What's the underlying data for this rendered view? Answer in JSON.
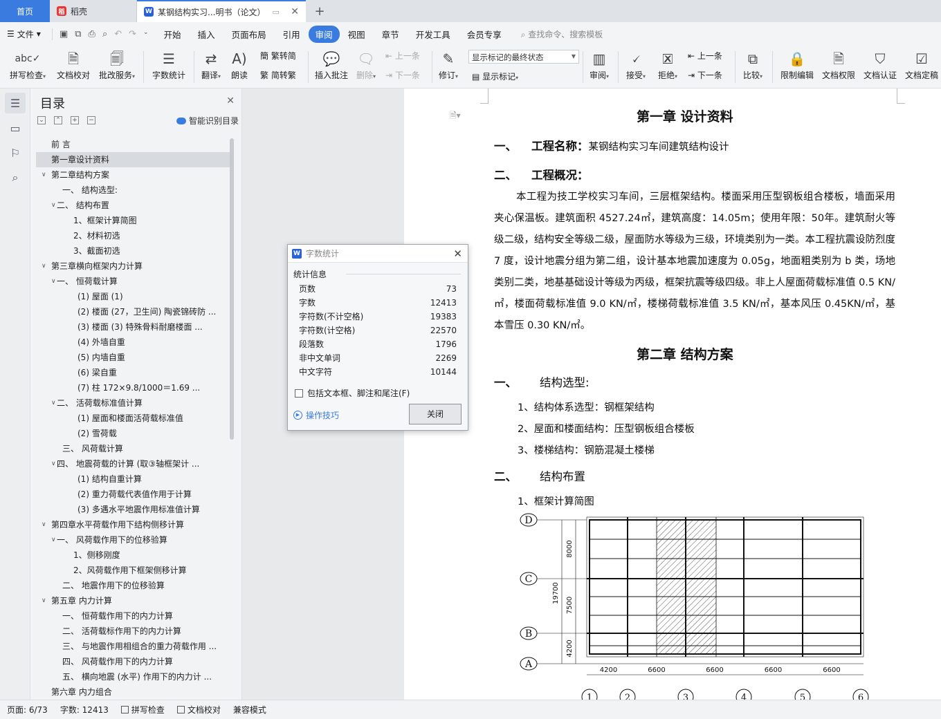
{
  "tabs": {
    "home": "首页",
    "daoke": "稻壳",
    "doc": "某钢结构实习...明书（论文）"
  },
  "menu": {
    "file": "文件",
    "items": [
      "开始",
      "插入",
      "页面布局",
      "引用",
      "审阅",
      "视图",
      "章节",
      "开发工具",
      "会员专享"
    ],
    "active": "审阅",
    "search": "查找命令、搜索模板"
  },
  "ribbon": {
    "spell": "拼写检查",
    "proof": "文档校对",
    "batch": "批改服务",
    "wordcount": "字数统计",
    "translate": "翻译",
    "read": "朗读",
    "to_trad": "繁转简",
    "to_simp": "简转繁",
    "insert_comment": "插入批注",
    "delete": "删除",
    "prev_comment": "上一条",
    "next_comment": "下一条",
    "revise": "修订",
    "markup_select": "显示标记的最终状态",
    "show_markup": "显示标记",
    "review": "审阅",
    "accept": "接受",
    "reject": "拒绝",
    "prev": "上一条",
    "next": "下一条",
    "compare": "比较",
    "restrict": "限制编辑",
    "permission": "文档权限",
    "certify": "文档认证",
    "finalize": "文档定稿"
  },
  "toc": {
    "title": "目录",
    "smart": "智能识别目录",
    "items": [
      {
        "text": "前  言",
        "level": 1,
        "toggle": ""
      },
      {
        "text": "第一章设计资料",
        "level": 1,
        "toggle": "",
        "current": true
      },
      {
        "text": "第二章结构方案",
        "level": 1,
        "toggle": "v"
      },
      {
        "text": "一、      结构选型:",
        "level": 3,
        "toggle": ""
      },
      {
        "text": "二、      结构布置",
        "level": 2,
        "toggle": "v"
      },
      {
        "text": "1、框架计算简图",
        "level": 4,
        "toggle": ""
      },
      {
        "text": "2、材料初选",
        "level": 4,
        "toggle": ""
      },
      {
        "text": "3、截面初选",
        "level": 4,
        "toggle": ""
      },
      {
        "text": "第三章横向框架内力计算",
        "level": 1,
        "toggle": "v"
      },
      {
        "text": "一、      恒荷载计算",
        "level": 2,
        "toggle": "v"
      },
      {
        "text": "(1) 屋面   (1)",
        "level": 5,
        "toggle": ""
      },
      {
        "text": "(2) 楼面 (27，卫生间) 陶瓷锦砖防 ...",
        "level": 5,
        "toggle": ""
      },
      {
        "text": "(3) 楼面 (3) 特殊骨料耐磨楼面     ...",
        "level": 5,
        "toggle": ""
      },
      {
        "text": "(4) 外墙自重",
        "level": 5,
        "toggle": ""
      },
      {
        "text": "(5) 内墙自重",
        "level": 5,
        "toggle": ""
      },
      {
        "text": "(6) 梁自重",
        "level": 5,
        "toggle": ""
      },
      {
        "text": "(7) 柱        172×9.8/1000＝1.69  ...",
        "level": 5,
        "toggle": ""
      },
      {
        "text": "二、      活荷载标准值计算",
        "level": 2,
        "toggle": "v"
      },
      {
        "text": "(1) 屋面和楼面活荷载标准值",
        "level": 5,
        "toggle": ""
      },
      {
        "text": "(2) 雪荷载",
        "level": 5,
        "toggle": ""
      },
      {
        "text": "三、      风荷载计算",
        "level": 3,
        "toggle": ""
      },
      {
        "text": "四、      地震荷载的计算 (取③轴框架计 ...",
        "level": 2,
        "toggle": "v"
      },
      {
        "text": "(1) 结构自重计算",
        "level": 5,
        "toggle": ""
      },
      {
        "text": "(2) 重力荷载代表值作用于计算",
        "level": 5,
        "toggle": ""
      },
      {
        "text": "(3) 多遇水平地震作用标准值计算",
        "level": 5,
        "toggle": ""
      },
      {
        "text": "第四章水平荷载作用下结构侧移计算",
        "level": 1,
        "toggle": "v"
      },
      {
        "text": "一、    风荷载作用下的位移验算",
        "level": 2,
        "toggle": "v"
      },
      {
        "text": "1、侧移刚度",
        "level": 4,
        "toggle": ""
      },
      {
        "text": "2、风荷载作用下框架侧移计算",
        "level": 4,
        "toggle": ""
      },
      {
        "text": "二、    地震作用下的位移验算",
        "level": 3,
        "toggle": ""
      },
      {
        "text": "第五章 内力计算",
        "level": 1,
        "toggle": "v"
      },
      {
        "text": "一、    恒荷载作用下的内力计算",
        "level": 3,
        "toggle": ""
      },
      {
        "text": "二、    活荷载标作用下的内力计算",
        "level": 3,
        "toggle": ""
      },
      {
        "text": "三、    与地震作用相组合的重力荷载作用 ...",
        "level": 3,
        "toggle": ""
      },
      {
        "text": "四、    风荷载作用下的内力计算",
        "level": 3,
        "toggle": ""
      },
      {
        "text": "五、    横向地震 (水平) 作用下的内力计 ...",
        "level": 3,
        "toggle": ""
      },
      {
        "text": "第六章 内力组合",
        "level": 1,
        "toggle": ""
      }
    ]
  },
  "dialog": {
    "title": "字数统计",
    "section": "统计信息",
    "rows": [
      {
        "label": "页数",
        "value": "73"
      },
      {
        "label": "字数",
        "value": "12413"
      },
      {
        "label": "字符数(不计空格)",
        "value": "19383"
      },
      {
        "label": "字符数(计空格)",
        "value": "22570"
      },
      {
        "label": "段落数",
        "value": "1796"
      },
      {
        "label": "非中文单词",
        "value": "2269"
      },
      {
        "label": "中文字符",
        "value": "10144"
      }
    ],
    "checkbox": "包括文本框、脚注和尾注(F)",
    "tip": "操作技巧",
    "close": "关闭"
  },
  "document": {
    "ch1_title": "第一章   设计资料",
    "s1_num": "一、",
    "s1_text": "工程名称：",
    "s1_value": "某钢结构实习车间建筑结构设计",
    "s2_num": "二、",
    "s2_text": "工程概况：",
    "para": "本工程为技工学校实习车间，三层框架结构。楼面采用压型钢板组合楼板，墙面采用夹心保温板。建筑面积 4527.24㎡，建筑高度：14.05m；使用年限：50年。建筑耐火等级二级，结构安全等级二级，屋面防水等级为三级，环境类别为一类。本工程抗震设防烈度 7 度，设计地震分组为第二组，设计基本地震加速度为 0.05g，地面粗类别为 b 类，场地类别二类，地基基础设计等级为丙级，框架抗震等级四级。非上人屋面荷载标准值 0.5 KN/㎡，楼面荷载标准值 9.0 KN/㎡，楼梯荷载标准值 3.5 KN/㎡，基本风压 0.45KN/㎡，基本雪压 0.30 KN/㎡。",
    "ch2_title": "第二章   结构方案",
    "c2s1_num": "一、",
    "c2s1_text": "结构选型:",
    "list": [
      "1、结构体系选型：钢框架结构",
      "2、屋面和楼面结构：压型钢板组合楼板",
      "3、楼梯结构：钢筋混凝土楼梯"
    ],
    "c2s2_num": "二、",
    "c2s2_text": "结构布置",
    "sub1": "1、框架计算简图"
  },
  "plan": {
    "row_labels": [
      "D",
      "C",
      "B",
      "A"
    ],
    "row_dims": [
      "8000",
      "7500",
      "4200"
    ],
    "total_dim": "19700",
    "col_dims": [
      "4200",
      "6600",
      "6600",
      "6600",
      "6600"
    ],
    "col_labels": [
      "1",
      "2",
      "3",
      "4",
      "5",
      "6"
    ]
  },
  "status": {
    "page": "页面: 6/73",
    "words": "字数: 12413",
    "spell": "拼写检查",
    "proof": "文档校对",
    "compat": "兼容模式"
  }
}
